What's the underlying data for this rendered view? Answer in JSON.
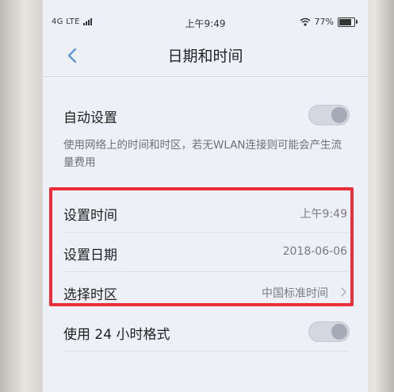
{
  "status_bar": {
    "network": "4G LTE",
    "time": "上午9:49",
    "battery": "77%",
    "battery_level": 0.77
  },
  "nav": {
    "title": "日期和时间"
  },
  "settings": {
    "auto_set": {
      "label": "自动设置",
      "enabled": false,
      "description": "使用网络上的时间和时区，若无WLAN连接则可能会产生流量费用"
    },
    "set_time": {
      "label": "设置时间",
      "value": "上午9:49"
    },
    "set_date": {
      "label": "设置日期",
      "value": "2018-06-06"
    },
    "select_timezone": {
      "label": "选择时区",
      "value": "中国标准时间"
    },
    "use_24h": {
      "label": "使用 24 小时格式",
      "enabled": false
    }
  },
  "colors": {
    "highlight_border": "#ea2e3a",
    "background": "#eef0f7",
    "toggle_off": "#d4d7e0"
  }
}
